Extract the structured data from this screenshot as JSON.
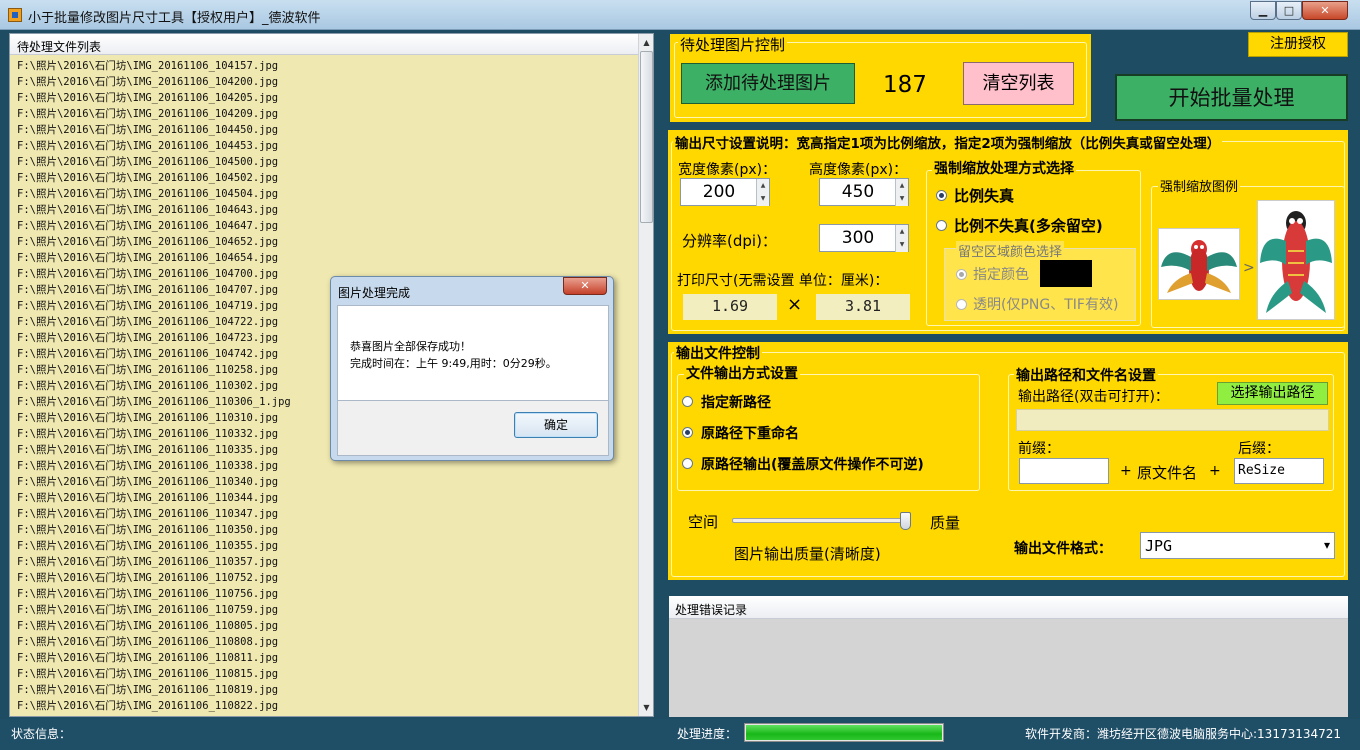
{
  "window": {
    "title": "小于批量修改图片尺寸工具【授权用户】_德波软件",
    "minimize": "▁",
    "maximize": "□",
    "close": "✕"
  },
  "file_list": {
    "header": "待处理文件列表",
    "scroll_up": "▲",
    "scroll_down": "▼",
    "items": [
      "F:\\照片\\2016\\石门坊\\IMG_20161106_104157.jpg",
      "F:\\照片\\2016\\石门坊\\IMG_20161106_104200.jpg",
      "F:\\照片\\2016\\石门坊\\IMG_20161106_104205.jpg",
      "F:\\照片\\2016\\石门坊\\IMG_20161106_104209.jpg",
      "F:\\照片\\2016\\石门坊\\IMG_20161106_104450.jpg",
      "F:\\照片\\2016\\石门坊\\IMG_20161106_104453.jpg",
      "F:\\照片\\2016\\石门坊\\IMG_20161106_104500.jpg",
      "F:\\照片\\2016\\石门坊\\IMG_20161106_104502.jpg",
      "F:\\照片\\2016\\石门坊\\IMG_20161106_104504.jpg",
      "F:\\照片\\2016\\石门坊\\IMG_20161106_104643.jpg",
      "F:\\照片\\2016\\石门坊\\IMG_20161106_104647.jpg",
      "F:\\照片\\2016\\石门坊\\IMG_20161106_104652.jpg",
      "F:\\照片\\2016\\石门坊\\IMG_20161106_104654.jpg",
      "F:\\照片\\2016\\石门坊\\IMG_20161106_104700.jpg",
      "F:\\照片\\2016\\石门坊\\IMG_20161106_104707.jpg",
      "F:\\照片\\2016\\石门坊\\IMG_20161106_104719.jpg",
      "F:\\照片\\2016\\石门坊\\IMG_20161106_104722.jpg",
      "F:\\照片\\2016\\石门坊\\IMG_20161106_104723.jpg",
      "F:\\照片\\2016\\石门坊\\IMG_20161106_104742.jpg",
      "F:\\照片\\2016\\石门坊\\IMG_20161106_110258.jpg",
      "F:\\照片\\2016\\石门坊\\IMG_20161106_110302.jpg",
      "F:\\照片\\2016\\石门坊\\IMG_20161106_110306_1.jpg",
      "F:\\照片\\2016\\石门坊\\IMG_20161106_110310.jpg",
      "F:\\照片\\2016\\石门坊\\IMG_20161106_110332.jpg",
      "F:\\照片\\2016\\石门坊\\IMG_20161106_110335.jpg",
      "F:\\照片\\2016\\石门坊\\IMG_20161106_110338.jpg",
      "F:\\照片\\2016\\石门坊\\IMG_20161106_110340.jpg",
      "F:\\照片\\2016\\石门坊\\IMG_20161106_110344.jpg",
      "F:\\照片\\2016\\石门坊\\IMG_20161106_110347.jpg",
      "F:\\照片\\2016\\石门坊\\IMG_20161106_110350.jpg",
      "F:\\照片\\2016\\石门坊\\IMG_20161106_110355.jpg",
      "F:\\照片\\2016\\石门坊\\IMG_20161106_110357.jpg",
      "F:\\照片\\2016\\石门坊\\IMG_20161106_110752.jpg",
      "F:\\照片\\2016\\石门坊\\IMG_20161106_110756.jpg",
      "F:\\照片\\2016\\石门坊\\IMG_20161106_110759.jpg",
      "F:\\照片\\2016\\石门坊\\IMG_20161106_110805.jpg",
      "F:\\照片\\2016\\石门坊\\IMG_20161106_110808.jpg",
      "F:\\照片\\2016\\石门坊\\IMG_20161106_110811.jpg",
      "F:\\照片\\2016\\石门坊\\IMG_20161106_110815.jpg",
      "F:\\照片\\2016\\石门坊\\IMG_20161106_110819.jpg",
      "F:\\照片\\2016\\石门坊\\IMG_20161106_110822.jpg"
    ]
  },
  "dialog": {
    "title": "图片处理完成",
    "close": "✕",
    "message_line1": "恭喜图片全部保存成功！",
    "message_line2": "完成时间在：上午 9:49,用时：0分29秒。",
    "ok_label": "确定"
  },
  "pending_control": {
    "title": "待处理图片控制",
    "add_label": "添加待处理图片",
    "count": "187",
    "clear_label": "清空列表"
  },
  "register_label": "注册授权",
  "start_label": "开始批量处理",
  "size_settings": {
    "title": "输出尺寸设置说明：宽高指定1项为比例缩放，指定2项为强制缩放（比例失真或留空处理）",
    "width_label": "宽度像素(px)：",
    "width_value": "200",
    "height_label": "高度像素(px)：",
    "height_value": "450",
    "dpi_label": "分辨率(dpi)：",
    "dpi_value": "300",
    "print_label": "打印尺寸(无需设置 单位：厘米)：",
    "print_width": "1.69",
    "times": "×",
    "print_height": "3.81",
    "spin_up": "▲",
    "spin_down": "▼"
  },
  "scale_mode": {
    "title": "强制缩放处理方式选择",
    "opt_distort": "比例失真",
    "opt_keep": "比例不失真(多余留空)",
    "fill_group_title": "留空区域颜色选择",
    "fill_color": "指定颜色",
    "fill_transparent": "透明(仅PNG、TIF有效)",
    "fill_color_value": "#000000"
  },
  "preview": {
    "title": "强制缩放图例",
    "arrow": ">"
  },
  "output_control": {
    "title": "输出文件控制",
    "mode_group_title": "文件输出方式设置",
    "opt_new_path": "指定新路径",
    "opt_rename": "原路径下重命名",
    "opt_overwrite": "原路径输出(覆盖原文件操作不可逆)",
    "path_group_title": "输出路径和文件名设置",
    "path_label": "输出路径(双击可打开)：",
    "choose_path": "选择输出路径",
    "path_value": "",
    "prefix_label": "前缀：",
    "prefix_value": "",
    "suffix_label": "后缀：",
    "suffix_value": "ReSize",
    "plus1": "+",
    "orig_name": "原文件名",
    "plus2": "+",
    "space_label": "空间",
    "quality_label": "质量",
    "quality_caption": "图片输出质量(清晰度)",
    "quality_level": 1.0,
    "format_label": "输出文件格式：",
    "format_value": "JPG",
    "format_arrow": "▾"
  },
  "error_log": {
    "header": "处理错误记录"
  },
  "status": {
    "info_label": "状态信息：",
    "progress_label": "处理进度：",
    "progress": 1.0,
    "developer": "软件开发商：潍坊经开区德波电脑服务中心:13173134721"
  },
  "colors": {
    "panel": "#ffd800",
    "list_bg": "#efe8b0",
    "accent_green": "#3cb065",
    "pink_button": "#ffc0cb",
    "status_bar": "#1f4e67"
  }
}
